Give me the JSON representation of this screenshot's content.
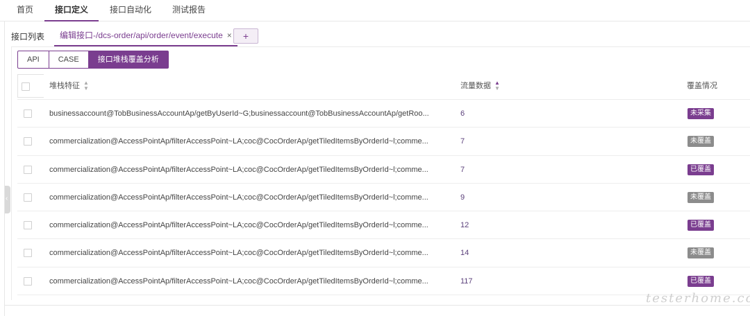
{
  "topnav": {
    "items": [
      {
        "label": "首页"
      },
      {
        "label": "接口定义",
        "active": true
      },
      {
        "label": "接口自动化"
      },
      {
        "label": "测试报告"
      }
    ]
  },
  "subtabs": {
    "list_label": "接口列表",
    "edit_label": "编辑接口-/dcs-order/api/order/event/execute",
    "close_icon": "×",
    "add_icon": "+"
  },
  "segments": [
    {
      "label": "API"
    },
    {
      "label": "CASE"
    },
    {
      "label": "接口堆栈覆盖分析",
      "active": true
    }
  ],
  "table": {
    "columns": {
      "signature": "堆栈特征",
      "flow": "流量数据",
      "coverage": "覆盖情况"
    },
    "rows": [
      {
        "signature": "businessaccount@TobBusinessAccountAp/getByUserId~G;businessaccount@TobBusinessAccountAp/getRoo...",
        "flow": "6",
        "status": "未采集",
        "status_color": "#7a3d8f"
      },
      {
        "signature": "commercialization@AccessPointAp/filterAccessPoint~LA;coc@CocOrderAp/getTiledItemsByOrderId~l;comme...",
        "flow": "7",
        "status": "未覆盖",
        "status_color": "#8c8c8c"
      },
      {
        "signature": "commercialization@AccessPointAp/filterAccessPoint~LA;coc@CocOrderAp/getTiledItemsByOrderId~l;comme...",
        "flow": "7",
        "status": "已覆盖",
        "status_color": "#7a3d8f"
      },
      {
        "signature": "commercialization@AccessPointAp/filterAccessPoint~LA;coc@CocOrderAp/getTiledItemsByOrderId~l;comme...",
        "flow": "9",
        "status": "未覆盖",
        "status_color": "#8c8c8c"
      },
      {
        "signature": "commercialization@AccessPointAp/filterAccessPoint~LA;coc@CocOrderAp/getTiledItemsByOrderId~l;comme...",
        "flow": "12",
        "status": "已覆盖",
        "status_color": "#7a3d8f"
      },
      {
        "signature": "commercialization@AccessPointAp/filterAccessPoint~LA;coc@CocOrderAp/getTiledItemsByOrderId~l;comme...",
        "flow": "14",
        "status": "未覆盖",
        "status_color": "#8c8c8c"
      },
      {
        "signature": "commercialization@AccessPointAp/filterAccessPoint~LA;coc@CocOrderAp/getTiledItemsByOrderId~l;comme...",
        "flow": "117",
        "status": "已覆盖",
        "status_color": "#7a3d8f"
      }
    ]
  },
  "watermark": "testerhome.com",
  "colors": {
    "accent": "#7a3d8f",
    "muted_badge": "#8c8c8c"
  }
}
